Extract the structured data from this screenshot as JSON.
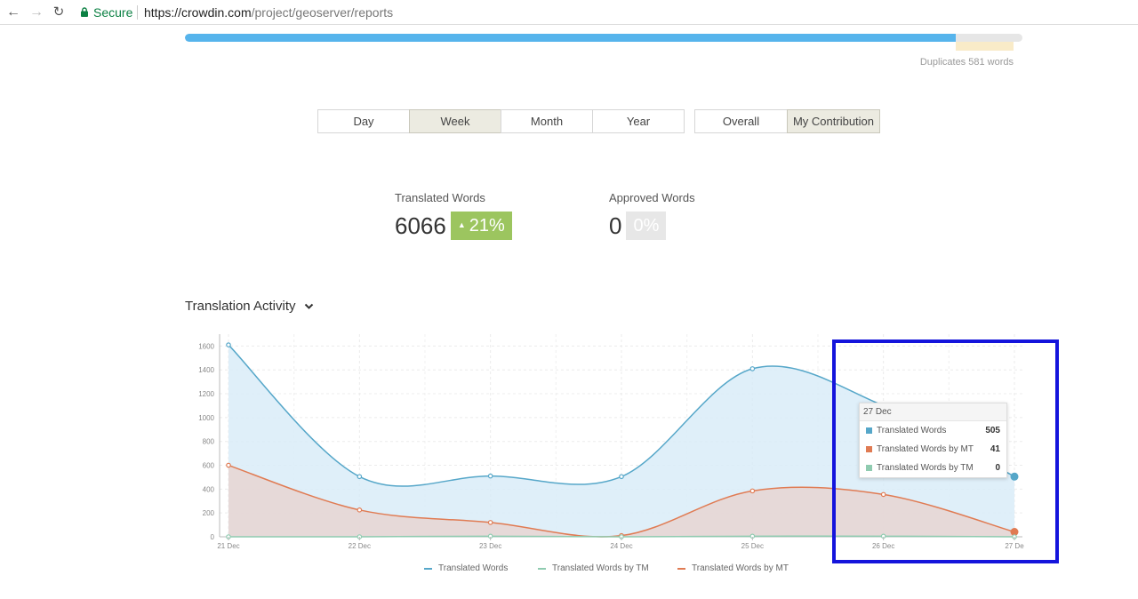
{
  "browser": {
    "secure_label": "Secure",
    "url_host": "https://crowdin.com",
    "url_path": "/project/geoserver/reports"
  },
  "progress": {
    "translated_fraction": 0.92,
    "duplicates_label": "Duplicates 581 words",
    "colors": {
      "fill": "#56b4ec",
      "duplicates": "#f9ebc8",
      "track": "#e6e6e6"
    }
  },
  "period_buttons": [
    {
      "label": "Day",
      "active": false
    },
    {
      "label": "Week",
      "active": true
    },
    {
      "label": "Month",
      "active": false
    },
    {
      "label": "Year",
      "active": false
    }
  ],
  "scope_buttons": [
    {
      "label": "Overall",
      "active": false
    },
    {
      "label": "My Contribution",
      "active": true
    }
  ],
  "stats": {
    "translated": {
      "label": "Translated Words",
      "value": "6066",
      "change": "21%",
      "arrow": "▲"
    },
    "approved": {
      "label": "Approved Words",
      "value": "0",
      "change": "0%"
    }
  },
  "section": {
    "title": "Translation Activity",
    "icon": "chevron-down-icon"
  },
  "chart_data": {
    "type": "area",
    "categories": [
      "21 Dec",
      "22 Dec",
      "23 Dec",
      "24 Dec",
      "25 Dec",
      "26 Dec",
      "27 De"
    ],
    "ylim": [
      0,
      1700
    ],
    "yticks": [
      "0",
      "200",
      "400",
      "600",
      "800",
      "1000",
      "1200",
      "1400",
      "1600"
    ],
    "grid": true,
    "legend_position": "bottom",
    "series": [
      {
        "name": "Translated Words",
        "values": [
          1610,
          505,
          510,
          505,
          1410,
          1100,
          505
        ],
        "color": "#56a7c9",
        "fill": "#d9ecf8"
      },
      {
        "name": "Translated Words by TM",
        "values": [
          0,
          0,
          5,
          0,
          5,
          5,
          0
        ],
        "color": "#8fcbb0",
        "fill": "none"
      },
      {
        "name": "Translated Words by MT",
        "values": [
          600,
          225,
          120,
          10,
          385,
          355,
          41
        ],
        "color": "#e07b53",
        "fill": "#e7d5d2"
      }
    ]
  },
  "tooltip": {
    "title": "27 Dec",
    "rows": [
      {
        "label": "Translated Words",
        "value": "505",
        "color": "#56a7c9"
      },
      {
        "label": "Translated Words by MT",
        "value": "41",
        "color": "#e07b53"
      },
      {
        "label": "Translated Words by TM",
        "value": "0",
        "color": "#8fcbb0"
      }
    ]
  },
  "legend": [
    {
      "label": "Translated Words",
      "color": "#56a7c9"
    },
    {
      "label": "Translated Words by TM",
      "color": "#8fcbb0"
    },
    {
      "label": "Translated Words by MT",
      "color": "#e07b53"
    }
  ],
  "highlight_color": "#1414dc"
}
